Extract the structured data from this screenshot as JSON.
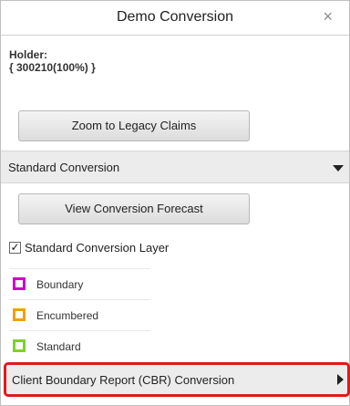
{
  "header": {
    "title": "Demo Conversion",
    "close_glyph": "×"
  },
  "holder": {
    "label": "Holder:",
    "value": "{ 300210(100%) }"
  },
  "buttons": {
    "zoom_legacy": "Zoom to Legacy Claims",
    "view_forecast": "View Conversion Forecast"
  },
  "standard_section": {
    "label": "Standard Conversion",
    "state": "expanded"
  },
  "layer": {
    "label": "Standard Conversion Layer",
    "checked": true,
    "check_glyph": "✓"
  },
  "legend": [
    {
      "label": "Boundary",
      "color": "#cc00cc"
    },
    {
      "label": "Encumbered",
      "color": "#f0a000"
    },
    {
      "label": "Standard",
      "color": "#7ed321"
    }
  ],
  "cbr_section": {
    "label": "Client Boundary Report (CBR) Conversion",
    "state": "collapsed",
    "highlight_color": "#e0191d"
  }
}
